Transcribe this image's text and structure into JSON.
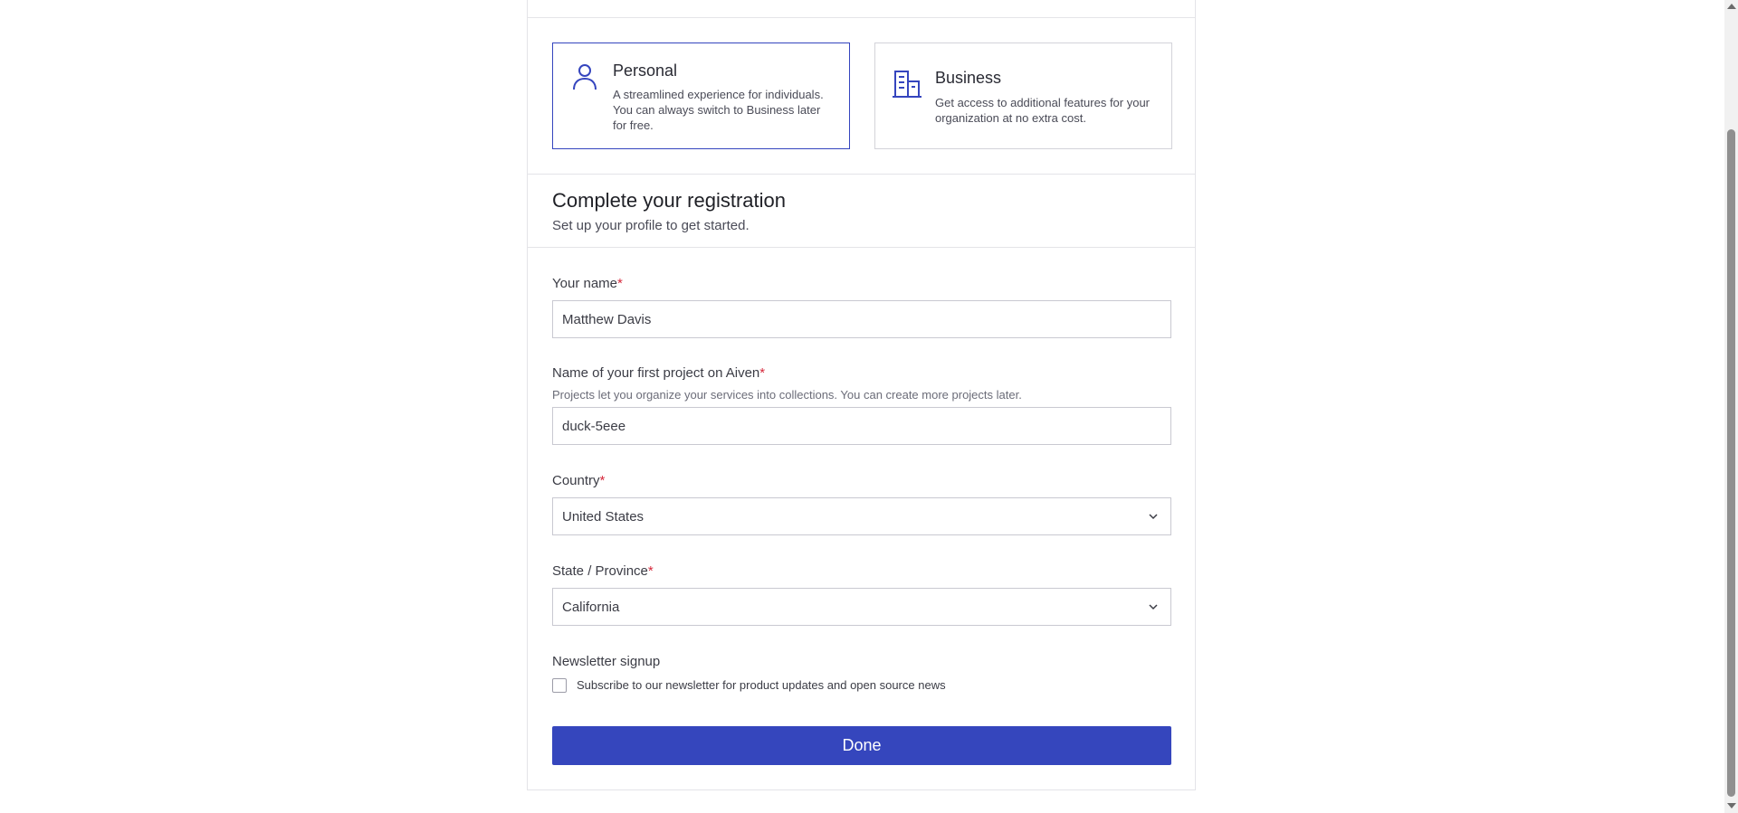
{
  "account_types": {
    "personal": {
      "title": "Personal",
      "description": "A streamlined experience for individuals. You can always switch to Business later for free.",
      "icon": "user-icon",
      "selected": true
    },
    "business": {
      "title": "Business",
      "description": "Get access to additional features for your organization at no extra cost.",
      "icon": "building-icon",
      "selected": false
    }
  },
  "registration": {
    "title": "Complete your registration",
    "subtitle": "Set up your profile to get started."
  },
  "form": {
    "required_marker": "*",
    "name": {
      "label": "Your name",
      "value": "Matthew Davis"
    },
    "project": {
      "label": "Name of your first project on Aiven",
      "help": "Projects let you organize your services into collections. You can create more projects later.",
      "value": "duck-5eee"
    },
    "country": {
      "label": "Country",
      "value": "United States",
      "icon": "chevron-down-icon"
    },
    "state": {
      "label": "State / Province",
      "value": "California",
      "icon": "chevron-down-icon"
    },
    "newsletter": {
      "label": "Newsletter signup",
      "checkbox_label": "Subscribe to our newsletter for product updates and open source news",
      "checked": false
    },
    "submit_label": "Done"
  },
  "colors": {
    "accent": "#3546bd",
    "required": "#d6293c",
    "border": "#c9c9d1"
  }
}
